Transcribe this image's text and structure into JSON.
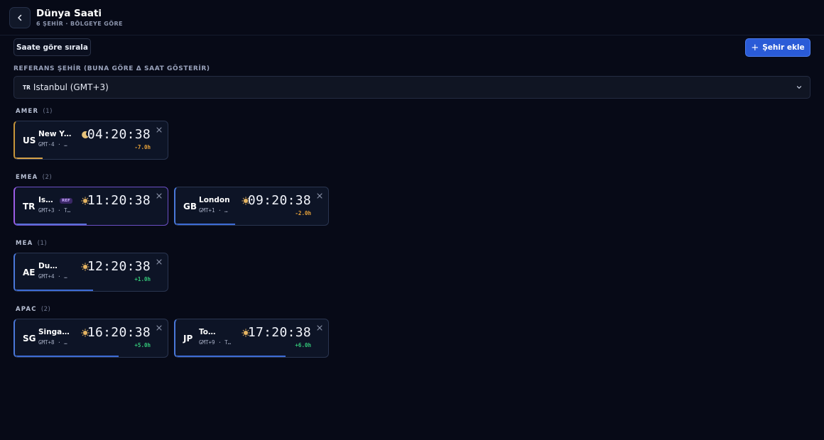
{
  "header": {
    "title": "Dünya Saati",
    "subtitle": "6 ŞEHİR · BÖLGEYE GÖRE"
  },
  "toolbar": {
    "sort_label": "Saate göre sırala",
    "add_label": "Şehir ekle"
  },
  "reference": {
    "label": "REFERANS ŞEHİR (BUNA GÖRE Δ SAAT GÖSTERİR)",
    "country_code": "TR",
    "value": "Istanbul (GMT+3)"
  },
  "regions": [
    {
      "name": "AMER",
      "count": "(1)",
      "cards": [
        {
          "code": "US",
          "city": "New York",
          "meta": "GMT-4 · …",
          "time": "04:20:38",
          "offset": "-7.0h",
          "day_icon": "moon-icon",
          "progress": 0.18
        }
      ]
    },
    {
      "name": "EMEA",
      "count": "(2)",
      "cards": [
        {
          "code": "TR",
          "city": "Istanbul",
          "badge": "REF",
          "meta": "GMT+3 · T…",
          "time": "11:20:38",
          "offset": "",
          "day_icon": "sun-icon",
          "progress": 0.47
        },
        {
          "code": "GB",
          "city": "London",
          "meta": "GMT+1 · …",
          "time": "09:20:38",
          "offset": "-2.0h",
          "day_icon": "sun-icon",
          "progress": 0.39
        }
      ]
    },
    {
      "name": "MEA",
      "count": "(1)",
      "cards": [
        {
          "code": "AE",
          "city": "Dubai",
          "meta": "GMT+4 · …",
          "time": "12:20:38",
          "offset": "+1.0h",
          "day_icon": "sun-icon",
          "progress": 0.51
        }
      ]
    },
    {
      "name": "APAC",
      "count": "(2)",
      "cards": [
        {
          "code": "SG",
          "city": "Singapore",
          "meta": "GMT+8 · …",
          "time": "16:20:38",
          "offset": "+5.0h",
          "day_icon": "sun-icon",
          "progress": 0.68
        },
        {
          "code": "JP",
          "city": "Tokyo",
          "meta": "GMT+9 · T…",
          "time": "17:20:38",
          "offset": "+6.0h",
          "day_icon": "sun-icon",
          "progress": 0.72
        }
      ]
    }
  ],
  "colors": {
    "background": "#070a17",
    "accent": "#2a5bd7",
    "ref_accent": "#9b5de5",
    "negative_offset": "#e8a33a",
    "positive_offset": "#33c778"
  }
}
